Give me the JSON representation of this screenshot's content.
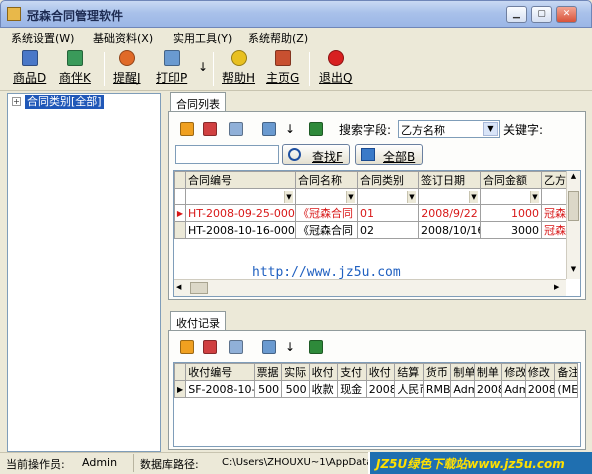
{
  "window": {
    "title": "冠森合同管理软件"
  },
  "menu": [
    "系统设置(W)",
    "基础资料(X)",
    "实用工具(Y)",
    "系统帮助(Z)"
  ],
  "toolbar": {
    "goods": "商品D",
    "partner": "商伴K",
    "remind": "提醒J",
    "print": "打印P",
    "print_arrow": "↓",
    "help": "帮助H",
    "home": "主页G",
    "exit": "退出Q"
  },
  "tree": {
    "expander": "+",
    "root": "合同类别[全部]"
  },
  "contracts": {
    "tab": "合同列表",
    "export_arrow": "↓",
    "search_field_label": "搜索字段:",
    "search_field_value": "乙方名称",
    "keyword_label": "关键字:",
    "find_label": "查找F",
    "all_label": "全部B",
    "columns": [
      "合同编号",
      "合同名称",
      "合同类别",
      "签订日期",
      "合同金额",
      "乙方"
    ],
    "rows": [
      [
        "HT-2008-09-25-00001",
        "《冠森合同",
        "01",
        "2008/9/22",
        "1000",
        "冠森"
      ],
      [
        "HT-2008-10-16-00002",
        "《冠森合同",
        "02",
        "2008/10/16",
        "3000",
        "冠森"
      ]
    ],
    "watermark": "http://www.jz5u.com"
  },
  "payments": {
    "tab": "收付记录",
    "export_arrow": "↓",
    "columns": [
      "收付编号",
      "票据",
      "实际",
      "收付",
      "支付",
      "收付",
      "结算",
      "货币",
      "制单",
      "制单",
      "修改",
      "修改",
      "备注"
    ],
    "rows": [
      [
        "SF-2008-10-0",
        "500",
        "500",
        "收款",
        "现金",
        "2008.",
        "人民币",
        "RMB",
        "Adm",
        "2008.",
        "Adm",
        "2008.",
        "(ME"
      ]
    ]
  },
  "status": {
    "operator_label": "当前操作员:",
    "operator": "Admin",
    "db_label": "数据库路径:",
    "db_path": "C:\\Users\\ZHOUXU~1\\AppData\\",
    "brand": "JZ5U绿色下载站www.jz5u.com"
  },
  "colors": {
    "selected_text": "#d81818",
    "tree_highlight": "#2058b8",
    "brand_bg": "#1f6fb0",
    "brand_text": "#ffe000"
  }
}
